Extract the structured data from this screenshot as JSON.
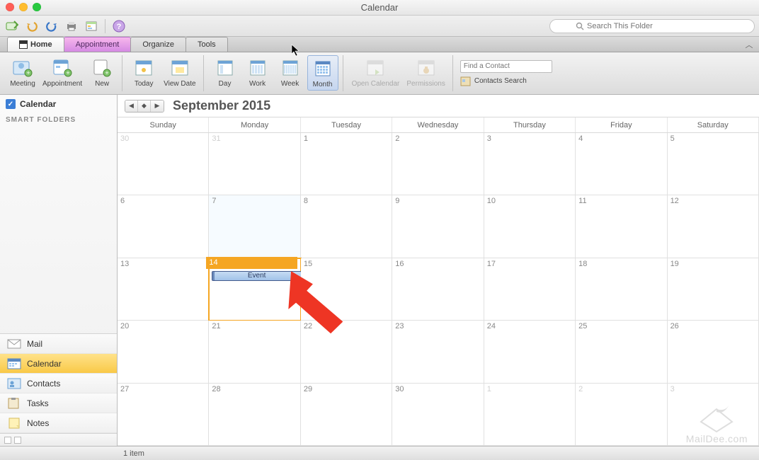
{
  "window": {
    "title": "Calendar"
  },
  "search_placeholder": "Search This Folder",
  "tabs": {
    "home": "Home",
    "appointment": "Appointment",
    "organize": "Organize",
    "tools": "Tools"
  },
  "ribbon": {
    "meeting": "Meeting",
    "appointment": "Appointment",
    "new": "New",
    "today": "Today",
    "viewdate": "View Date",
    "day": "Day",
    "work": "Work",
    "week": "Week",
    "month": "Month",
    "opencal": "Open Calendar",
    "perms": "Permissions",
    "find_contact_placeholder": "Find a Contact",
    "contacts_search": "Contacts Search"
  },
  "sidebar": {
    "calendar_checkbox": "Calendar",
    "smart_folders": "SMART FOLDERS",
    "nav": {
      "mail": "Mail",
      "calendar": "Calendar",
      "contacts": "Contacts",
      "tasks": "Tasks",
      "notes": "Notes"
    }
  },
  "calendar": {
    "month_label": "September 2015",
    "days": [
      "Sunday",
      "Monday",
      "Tuesday",
      "Wednesday",
      "Thursday",
      "Friday",
      "Saturday"
    ],
    "cells": [
      {
        "n": "30",
        "cls": "prev"
      },
      {
        "n": "31",
        "cls": "prev"
      },
      {
        "n": "1"
      },
      {
        "n": "2"
      },
      {
        "n": "3"
      },
      {
        "n": "4"
      },
      {
        "n": "5"
      },
      {
        "n": "6"
      },
      {
        "n": "7",
        "cls": "col-mon row2"
      },
      {
        "n": "8"
      },
      {
        "n": "9"
      },
      {
        "n": "10"
      },
      {
        "n": "11"
      },
      {
        "n": "12"
      },
      {
        "n": "13"
      },
      {
        "n": "14",
        "cls": "selected"
      },
      {
        "n": "15"
      },
      {
        "n": "16"
      },
      {
        "n": "17"
      },
      {
        "n": "18"
      },
      {
        "n": "19"
      },
      {
        "n": "20"
      },
      {
        "n": "21"
      },
      {
        "n": "22"
      },
      {
        "n": "23"
      },
      {
        "n": "24"
      },
      {
        "n": "25"
      },
      {
        "n": "26"
      },
      {
        "n": "27"
      },
      {
        "n": "28"
      },
      {
        "n": "29"
      },
      {
        "n": "30"
      },
      {
        "n": "1",
        "cls": "next"
      },
      {
        "n": "2",
        "cls": "next"
      },
      {
        "n": "3",
        "cls": "next"
      }
    ],
    "event_label": "Event",
    "selected_index": 15
  },
  "status": {
    "items": "1 item"
  },
  "watermark": "MailDee.com"
}
